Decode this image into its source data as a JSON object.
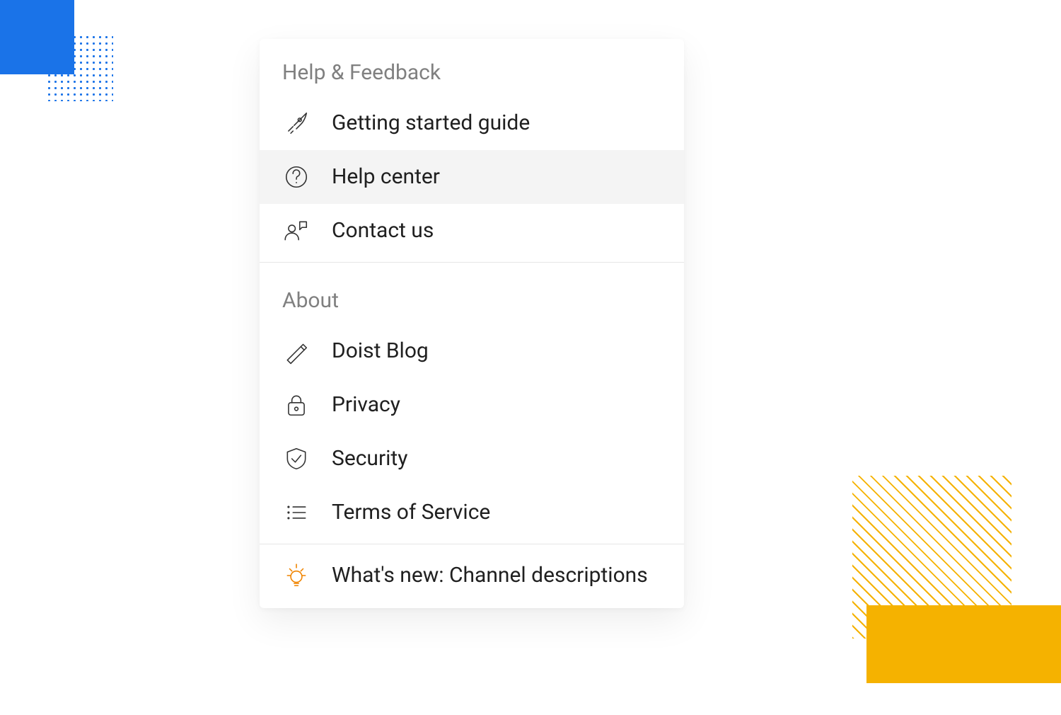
{
  "menu": {
    "sections": [
      {
        "title": "Help & Feedback",
        "items": [
          {
            "icon": "rocket-icon",
            "label": "Getting started guide",
            "hover": false
          },
          {
            "icon": "question-icon",
            "label": "Help center",
            "hover": true
          },
          {
            "icon": "contact-icon",
            "label": "Contact us",
            "hover": false
          }
        ]
      },
      {
        "title": "About",
        "items": [
          {
            "icon": "pencil-icon",
            "label": "Doist Blog",
            "hover": false
          },
          {
            "icon": "lock-icon",
            "label": "Privacy",
            "hover": false
          },
          {
            "icon": "shield-icon",
            "label": "Security",
            "hover": false
          },
          {
            "icon": "list-icon",
            "label": "Terms of Service",
            "hover": false
          }
        ]
      },
      {
        "title": null,
        "items": [
          {
            "icon": "lightbulb-icon",
            "label": "What's new: Channel descriptions",
            "hover": false,
            "accent": true
          }
        ]
      }
    ]
  },
  "colors": {
    "accent_orange": "#f08400",
    "deco_blue": "#1a73e8",
    "deco_yellow": "#f5b200"
  }
}
